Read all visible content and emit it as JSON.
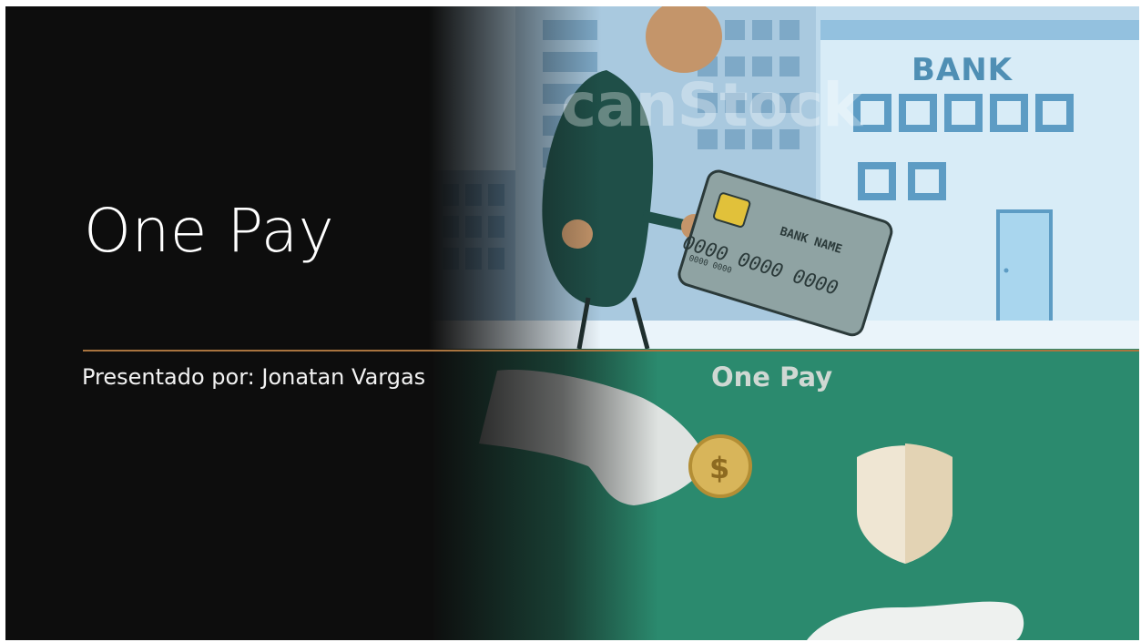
{
  "slide": {
    "title": "One Pay",
    "subtitle": "Presentado por:  Jonatan Vargas"
  },
  "illustration": {
    "bank_sign": "BANK",
    "card_bank_name": "BANK NAME",
    "card_number": "0000 0000 0000",
    "card_number_small": "0000 0000",
    "watermark": "canStock",
    "lower_heading": "One Pay"
  },
  "colors": {
    "background": "#0d0d0d",
    "accent_rule": "#a9743f",
    "sky": "#cfe5f3",
    "green_panel": "#2b8a6e"
  }
}
